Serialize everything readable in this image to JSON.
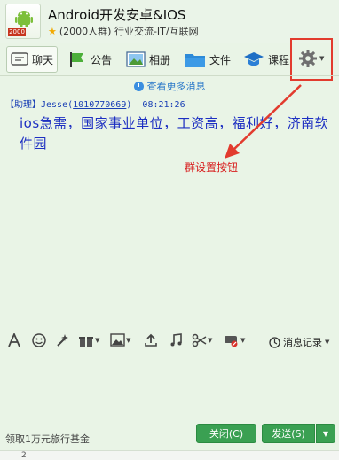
{
  "header": {
    "group_name": "Android开发安卓&IOS",
    "group_meta": "(2000人群) 行业交流-IT/互联网",
    "avatar_badge": "2000"
  },
  "tabs": [
    {
      "label": "聊天",
      "icon": "chat-icon"
    },
    {
      "label": "公告",
      "icon": "announcement-icon"
    },
    {
      "label": "相册",
      "icon": "album-icon"
    },
    {
      "label": "文件",
      "icon": "folder-icon"
    },
    {
      "label": "课程",
      "icon": "course-icon"
    }
  ],
  "settings": {
    "icon": "gear-icon"
  },
  "chat": {
    "more_messages": "查看更多消息",
    "message": {
      "role": "【助理】",
      "sender": "Jesse",
      "qq": "1010770669",
      "time": "08:21:26",
      "text": "ios急需，国家事业单位，工资高，福利好，济南软件园"
    }
  },
  "annotation": {
    "label": "群设置按钮"
  },
  "toolbar": {
    "icons": [
      "font-icon",
      "emoji-icon",
      "magic-icon",
      "gift-icon",
      "image-icon",
      "upload-icon",
      "music-icon",
      "screenshot-icon",
      "shake-icon"
    ],
    "history_label": "消息记录"
  },
  "footer": {
    "promo_text": "领取1万元旅行基金",
    "close_label": "关闭(C)",
    "send_label": "发送(S)",
    "bottom_number": "2"
  },
  "colors": {
    "accent_green": "#3aa052",
    "link_blue": "#2a78c9",
    "message_blue": "#1d2fc2",
    "annotation_red": "#d81e1e"
  }
}
